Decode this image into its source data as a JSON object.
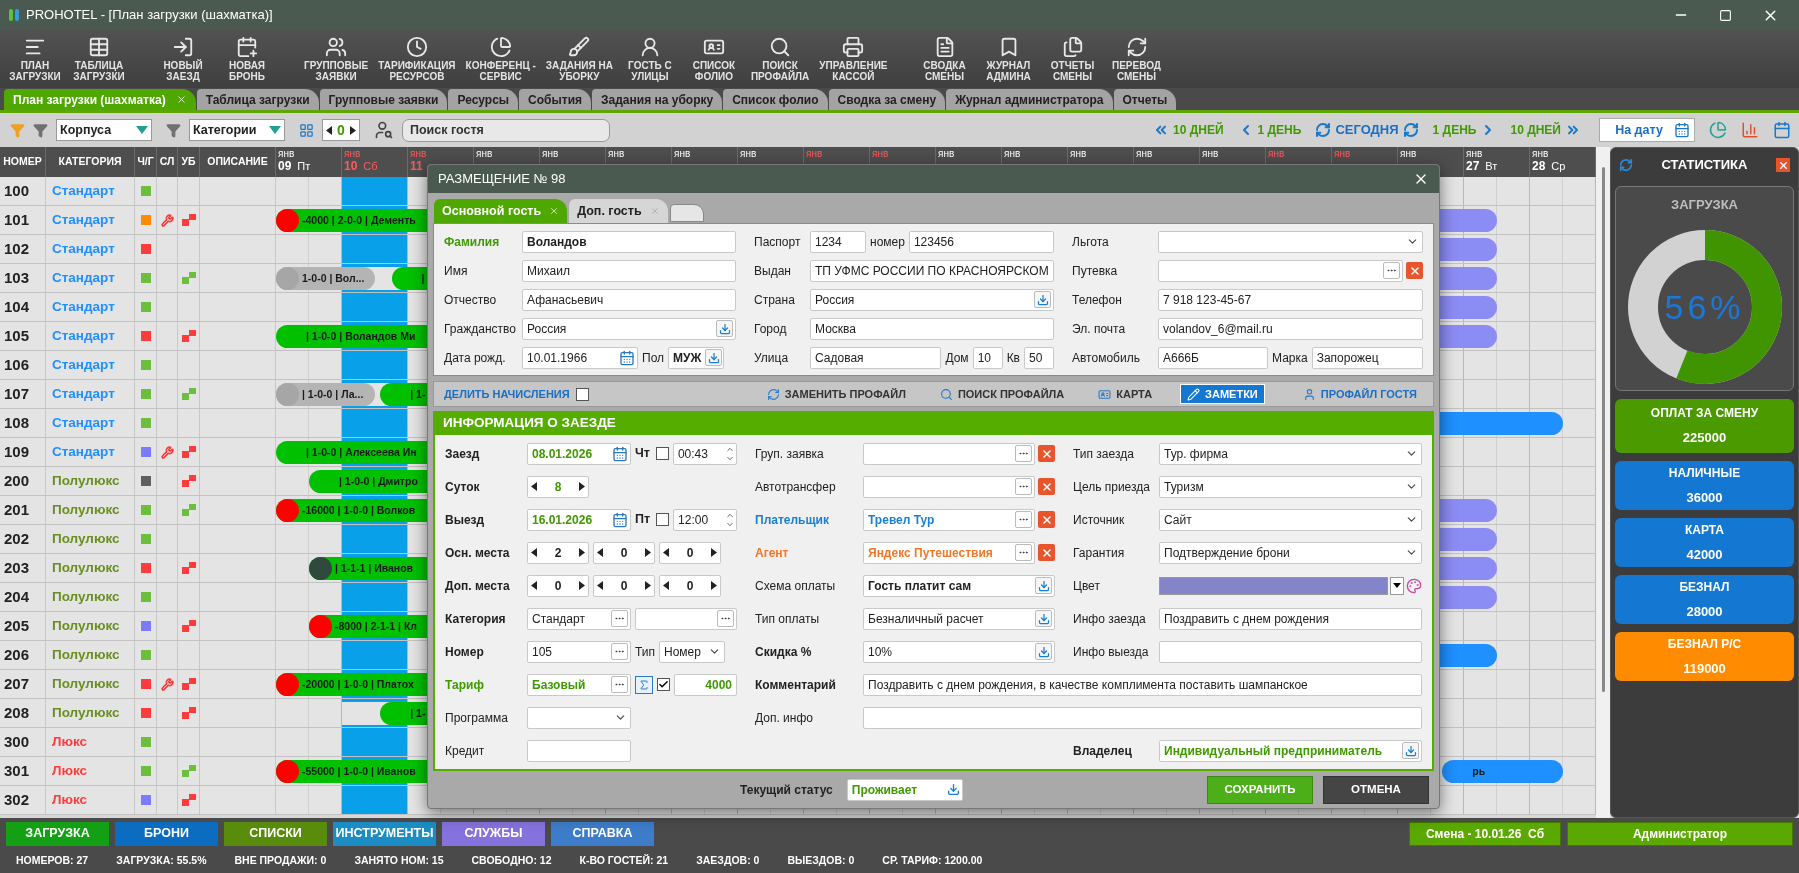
{
  "window": {
    "title": "PROHOTEL - [План загрузки (шахматка)]"
  },
  "toolbar": {
    "groups": [
      {
        "buttons": [
          "ПЛАН\nЗАГРУЗКИ",
          "ТАБЛИЦА\nЗАГРУЗКИ"
        ]
      },
      {
        "buttons": [
          "НОВЫЙ\nЗАЕЗД",
          "НОВАЯ\nБРОНЬ"
        ]
      },
      {
        "buttons": [
          "ГРУППОВЫЕ\nЗАЯВКИ",
          "ТАРИФИКАЦИЯ\nРЕСУРСОВ",
          "КОНФЕРЕНЦ -\nСЕРВИС",
          "ЗАДАНИЯ НА\nУБОРКУ",
          "ГОСТЬ С\nУЛИЦЫ",
          "СПИСОК\nФОЛИО",
          "ПОИСК\nПРОФАЙЛА",
          "УПРАВЛЕНИЕ\nКАССОЙ"
        ]
      },
      {
        "buttons": [
          "СВОДКА\nСМЕНЫ",
          "ЖУРНАЛ\nАДМИНА",
          "ОТЧЕТЫ\nСМЕНЫ",
          "ПЕРЕВОД\nСМЕНЫ"
        ]
      }
    ]
  },
  "tabs": [
    {
      "label": "План загрузки (шахматка)",
      "selected": true,
      "closable": true
    },
    {
      "label": "Таблица загрузки",
      "selected": false,
      "closable": false
    },
    {
      "label": "Групповые заявки",
      "selected": false,
      "closable": false
    },
    {
      "label": "Ресурсы",
      "selected": false,
      "closable": false
    },
    {
      "label": "События",
      "selected": false,
      "closable": false
    },
    {
      "label": "Задания на уборку",
      "selected": false,
      "closable": false
    },
    {
      "label": "Список фолио",
      "selected": false,
      "closable": false
    },
    {
      "label": "Сводка за смену",
      "selected": false,
      "closable": false
    },
    {
      "label": "Журнал администратора",
      "selected": false,
      "closable": false
    },
    {
      "label": "Отчеты",
      "selected": false,
      "closable": false
    }
  ],
  "filters": {
    "building": "Корпуса",
    "category": "Категории",
    "counter": "0",
    "search": {
      "placeholder": "Поиск гостя"
    }
  },
  "navigation": [
    {
      "label": "10 ДНЕЙ",
      "kind": "back10"
    },
    {
      "label": "1 ДЕНЬ",
      "kind": "back1"
    },
    {
      "label": "СЕГОДНЯ",
      "kind": "today"
    },
    {
      "label": "1 ДЕНЬ",
      "kind": "fwd1"
    },
    {
      "label": "10 ДНЕЙ",
      "kind": "fwd10"
    }
  ],
  "date_button": "На дату",
  "grid": {
    "columns": [
      "НОМЕР",
      "КАТЕГОРИЯ",
      "Ч/Г",
      "СЛ",
      "УБ",
      "ОПИСАНИЕ"
    ],
    "days": [
      {
        "month": "янв",
        "day": "09",
        "weekday": "Пт",
        "weekend": false,
        "today": false
      },
      {
        "month": "янв",
        "day": "10",
        "weekday": "Сб",
        "weekend": true,
        "today": true
      },
      {
        "month": "янв",
        "day": "11",
        "weekend": true,
        "today": false
      },
      {
        "month": "янв",
        "weekend": false
      },
      {
        "month": "янв",
        "weekend": false
      },
      {
        "month": "янв",
        "weekend": false
      },
      {
        "month": "янв",
        "weekend": false
      },
      {
        "month": "янв",
        "weekend": false
      },
      {
        "month": "янв",
        "weekend": true
      },
      {
        "month": "янв",
        "weekend": true
      },
      {
        "month": "янв",
        "weekend": false
      },
      {
        "month": "янв",
        "weekend": false
      },
      {
        "month": "янв",
        "weekend": false
      },
      {
        "month": "янв",
        "weekend": false
      },
      {
        "month": "янв",
        "weekend": false
      },
      {
        "month": "янв",
        "weekend": true
      },
      {
        "month": "янв",
        "weekend": true
      },
      {
        "month": "янв",
        "weekend": false
      },
      {
        "month": "янв",
        "day": "27",
        "weekday": "Вт",
        "weekend": false,
        "today": false
      },
      {
        "month": "янв",
        "day": "28",
        "weekday": "Ср",
        "weekend": false,
        "today": false
      }
    ],
    "rows": [
      {
        "number": "100",
        "category": {
          "label": "Стандарт",
          "color": "#1e90ff"
        },
        "status": {
          "color": "#6cbf3c"
        },
        "repair": false
      },
      {
        "number": "101",
        "category": {
          "label": "Стандарт",
          "color": "#1e90ff"
        },
        "status": {
          "color": "#ff8c00"
        },
        "repair": true,
        "cleaning": {
          "kind": "dirty"
        },
        "bookings": [
          {
            "text": "-4000 | 2-0-0 | Дементь",
            "color": "#00c000",
            "dot": {
              "color": "#ff0000"
            }
          },
          {
            "color": "#8c8cf5"
          }
        ]
      },
      {
        "number": "102",
        "category": {
          "label": "Стандарт",
          "color": "#1e90ff"
        },
        "status": {
          "color": "#ff3b3b"
        },
        "repair": false,
        "bookings": [
          {
            "color": "#8c8cf5"
          }
        ]
      },
      {
        "number": "103",
        "category": {
          "label": "Стандарт",
          "color": "#1e90ff"
        },
        "status": {
          "color": "#6cbf3c"
        },
        "repair": false,
        "cleaning": {
          "kind": "clean"
        },
        "bookings": [
          {
            "text": "1-0-0 | Вол...",
            "color": "#b4b4b4",
            "dot": {
              "color": "#a6a6a6"
            }
          },
          {
            "text": "|",
            "color": "#00c000"
          },
          {
            "color": "#8c8cf5"
          }
        ]
      },
      {
        "number": "104",
        "category": {
          "label": "Стандарт",
          "color": "#1e90ff"
        },
        "status": {
          "color": "#6cbf3c"
        },
        "repair": false,
        "bookings": [
          {
            "color": "#8c8cf5"
          }
        ]
      },
      {
        "number": "105",
        "category": {
          "label": "Стандарт",
          "color": "#1e90ff"
        },
        "status": {
          "color": "#ff3b3b"
        },
        "repair": false,
        "cleaning": {
          "kind": "dirty"
        },
        "bookings": [
          {
            "text": "| 1-0-0 | Воландов Ми",
            "color": "#00c000"
          },
          {
            "color": "#8c8cf5"
          }
        ]
      },
      {
        "number": "106",
        "category": {
          "label": "Стандарт",
          "color": "#1e90ff"
        },
        "status": {
          "color": "#6cbf3c"
        },
        "repair": false
      },
      {
        "number": "107",
        "category": {
          "label": "Стандарт",
          "color": "#1e90ff"
        },
        "status": {
          "color": "#6cbf3c"
        },
        "repair": false,
        "cleaning": {
          "kind": "clean"
        },
        "bookings": [
          {
            "text": "| 1-0-0 | Ла...",
            "color": "#b4b4b4",
            "dot": {
              "color": "#a6a6a6"
            }
          },
          {
            "text": "| 1-",
            "color": "#00c000"
          }
        ]
      },
      {
        "number": "108",
        "category": {
          "label": "Стандарт",
          "color": "#1e90ff"
        },
        "status": {
          "color": "#6cbf3c"
        },
        "repair": false,
        "bookings": [
          {
            "color": "#1e90ff"
          }
        ]
      },
      {
        "number": "109",
        "category": {
          "label": "Стандарт",
          "color": "#1e90ff"
        },
        "status": {
          "color": "#7b7bff"
        },
        "repair": true,
        "cleaning": {
          "kind": "dirty"
        },
        "bookings": [
          {
            "text": "| 1-0-0 | Алексеева Ин",
            "color": "#00c000"
          }
        ]
      },
      {
        "number": "200",
        "category": {
          "label": "Полулюкс",
          "color": "#6b8e23"
        },
        "status": {
          "color": "#5f5f5f"
        },
        "repair": false,
        "cleaning": {
          "kind": "dirty"
        },
        "bookings": [
          {
            "text": "| 1-0-0 | Дмитро",
            "color": "#00c000"
          }
        ]
      },
      {
        "number": "201",
        "category": {
          "label": "Полулюкс",
          "color": "#6b8e23"
        },
        "status": {
          "color": "#6cbf3c"
        },
        "repair": false,
        "cleaning": {
          "kind": "clean"
        },
        "bookings": [
          {
            "text": "-16000 | 1-0-0 | Волков",
            "color": "#00c000",
            "dot": {
              "color": "#ff0000"
            }
          },
          {
            "color": "#8c8cf5"
          }
        ]
      },
      {
        "number": "202",
        "category": {
          "label": "Полулюкс",
          "color": "#6b8e23"
        },
        "status": {
          "color": "#6cbf3c"
        },
        "repair": false,
        "bookings": [
          {
            "color": "#8c8cf5"
          }
        ]
      },
      {
        "number": "203",
        "category": {
          "label": "Полулюкс",
          "color": "#6b8e23"
        },
        "status": {
          "color": "#ff3b3b"
        },
        "repair": false,
        "cleaning": {
          "kind": "dirty"
        },
        "bookings": [
          {
            "text": "| 1-1-1 | Иванов",
            "color": "#00c000",
            "dot": {
              "color": "#2f4a3c"
            }
          },
          {
            "color": "#8c8cf5"
          }
        ]
      },
      {
        "number": "204",
        "category": {
          "label": "Полулюкс",
          "color": "#6b8e23"
        },
        "status": {
          "color": "#6cbf3c"
        },
        "repair": false,
        "bookings": [
          {
            "color": "#8c8cf5"
          }
        ]
      },
      {
        "number": "205",
        "category": {
          "label": "Полулюкс",
          "color": "#6b8e23"
        },
        "status": {
          "color": "#7b7bff"
        },
        "repair": false,
        "cleaning": {
          "kind": "dirty"
        },
        "bookings": [
          {
            "text": "-8000 | 2-1-1 | Кл",
            "color": "#00c000",
            "dot": {
              "color": "#ff0000"
            }
          }
        ]
      },
      {
        "number": "206",
        "category": {
          "label": "Полулюкс",
          "color": "#6b8e23"
        },
        "status": {
          "color": "#6cbf3c"
        },
        "repair": false,
        "bookings": [
          {
            "color": "#1e90ff"
          }
        ]
      },
      {
        "number": "207",
        "category": {
          "label": "Полулюкс",
          "color": "#6b8e23"
        },
        "status": {
          "color": "#ff3b3b"
        },
        "repair": true,
        "cleaning": {
          "kind": "dirty"
        },
        "bookings": [
          {
            "text": "-20000 | 1-0-0 | Платох",
            "color": "#00c000",
            "dot": {
              "color": "#ff0000"
            }
          }
        ]
      },
      {
        "number": "208",
        "category": {
          "label": "Полулюкс",
          "color": "#6b8e23"
        },
        "status": {
          "color": "#ff3b3b"
        },
        "repair": false,
        "cleaning": {
          "kind": "dirty"
        },
        "bookings": [
          {
            "text": "| 1-",
            "color": "#00c000"
          }
        ]
      },
      {
        "number": "300",
        "category": {
          "label": "Люкс",
          "color": "#ff3b3b"
        },
        "status": {
          "color": "#6cbf3c"
        },
        "repair": false
      },
      {
        "number": "301",
        "category": {
          "label": "Люкс",
          "color": "#ff3b3b"
        },
        "status": {
          "color": "#6cbf3c"
        },
        "repair": false,
        "cleaning": {
          "kind": "clean"
        },
        "bookings": [
          {
            "text": "-55000 | 1-0-0 | Иванов",
            "color": "#00c000",
            "dot": {
              "color": "#ff0000"
            }
          },
          {
            "text": "рь",
            "color": "#1e90ff"
          }
        ]
      },
      {
        "number": "302",
        "category": {
          "label": "Люкс",
          "color": "#ff3b3b"
        },
        "status": {
          "color": "#7b7bff"
        },
        "repair": false,
        "cleaning": {
          "kind": "dirty"
        }
      }
    ]
  },
  "dialog": {
    "title": "РАЗМЕЩЕНИЕ № 98",
    "tabs": [
      {
        "label": "Основной гость",
        "selected": true
      },
      {
        "label": "Доп. гость",
        "selected": false
      }
    ],
    "guest": {
      "rows": [
        {
          "cells": [
            {
              "label": "Фамилия",
              "color": "#3f9a00",
              "bold": true,
              "parts": [
                {
                  "kind": "text",
                  "value": "Воландов",
                  "bold": true
                }
              ]
            },
            {
              "label": "Паспорт",
              "parts": [
                {
                  "kind": "text",
                  "value": "1234"
                },
                {
                  "label": "номер",
                  "kind": "text",
                  "value": "123456"
                }
              ]
            },
            {
              "label": "Льгота",
              "parts": [
                {
                  "kind": "select"
                }
              ]
            }
          ]
        },
        {
          "cells": [
            {
              "label": "Имя",
              "parts": [
                {
                  "kind": "text",
                  "value": "Михаил"
                }
              ]
            },
            {
              "label": "Выдан",
              "parts": [
                {
                  "kind": "text",
                  "value": "ТП УФМС РОССИИ ПО КРАСНОЯРСКОМ"
                }
              ]
            },
            {
              "label": "Путевка",
              "parts": [
                {
                  "kind": "lookup"
                }
              ]
            }
          ]
        },
        {
          "cells": [
            {
              "label": "Отчество",
              "parts": [
                {
                  "kind": "text",
                  "value": "Афанасьевич"
                }
              ]
            },
            {
              "label": "Страна",
              "parts": [
                {
                  "kind": "picker",
                  "value": "Россия"
                }
              ]
            },
            {
              "label": "Телефон",
              "parts": [
                {
                  "kind": "text",
                  "value": "7 918 123-45-67"
                }
              ]
            }
          ]
        },
        {
          "cells": [
            {
              "label": "Гражданство",
              "parts": [
                {
                  "kind": "picker",
                  "value": "Россия"
                }
              ]
            },
            {
              "label": "Город",
              "parts": [
                {
                  "kind": "text",
                  "value": "Москва"
                }
              ]
            },
            {
              "label": "Эл. почта",
              "parts": [
                {
                  "kind": "text",
                  "value": "volandov_6@mail.ru"
                }
              ]
            }
          ]
        },
        {
          "cells": [
            {
              "label": "Дата рожд.",
              "parts": [
                {
                  "kind": "date",
                  "value": "10.01.1966"
                },
                {
                  "label": "Пол",
                  "kind": "picker",
                  "value": "МУЖ",
                  "bold": true
                }
              ]
            },
            {
              "label": "Улица",
              "parts": [
                {
                  "kind": "text",
                  "value": "Садовая"
                },
                {
                  "label": "Дом",
                  "kind": "text",
                  "value": "10"
                },
                {
                  "label": "Кв",
                  "kind": "text",
                  "value": "50"
                }
              ]
            },
            {
              "label": "Автомобиль",
              "parts": [
                {
                  "kind": "text",
                  "value": "А666Б"
                },
                {
                  "label": "Марка",
                  "kind": "text",
                  "value": "Запорожец"
                }
              ]
            }
          ]
        }
      ]
    },
    "actions": [
      {
        "label": "ДЕЛИТЬ НАЧИСЛЕНИЯ",
        "kind": "check",
        "checked": false
      },
      {
        "label": "ЗАМЕНИТЬ ПРОФАЙЛ",
        "kind": "replace",
        "selected": false
      },
      {
        "label": "ПОИСК ПРОФАЙЛА",
        "kind": "search",
        "selected": false
      },
      {
        "label": "КАРТА",
        "kind": "card",
        "selected": false
      },
      {
        "label": "ЗАМЕТКИ",
        "kind": "notes",
        "selected": true
      },
      {
        "label": "ПРОФАЙЛ ГОСТЯ",
        "kind": "profile",
        "selected": false
      }
    ],
    "section_title": "ИНФОРМАЦИЯ О ЗАЕЗДЕ",
    "arrival": {
      "rows": [
        {
          "cells": [
            {
              "label": "Заезд",
              "bold": true,
              "parts": [
                {
                  "kind": "date",
                  "value": "08.01.2026",
                  "color": "#3f9a00",
                  "bold": true
                },
                {
                  "kind": "check",
                  "label": "Чт",
                  "checked": false
                },
                {
                  "kind": "time",
                  "value": "00:43"
                }
              ]
            },
            {
              "label": "Груп. заявка",
              "parts": [
                {
                  "kind": "lookup"
                }
              ]
            },
            {
              "label": "Тип заезда",
              "parts": [
                {
                  "kind": "select",
                  "value": "Тур. фирма"
                }
              ]
            }
          ]
        },
        {
          "cells": [
            {
              "label": "Суток",
              "bold": true,
              "parts": [
                {
                  "kind": "spin",
                  "value": "8",
                  "color": "#3f9a00",
                  "bold": true
                }
              ]
            },
            {
              "label": "Автотрансфер",
              "parts": [
                {
                  "kind": "lookup"
                }
              ]
            },
            {
              "label": "Цель приезда",
              "parts": [
                {
                  "kind": "select",
                  "value": "Туризм"
                }
              ]
            }
          ]
        },
        {
          "cells": [
            {
              "label": "Выезд",
              "bold": true,
              "parts": [
                {
                  "kind": "date",
                  "value": "16.01.2026",
                  "color": "#3f9a00",
                  "bold": true
                },
                {
                  "kind": "check",
                  "label": "Пт",
                  "checked": false
                },
                {
                  "kind": "time",
                  "value": "12:00"
                }
              ]
            },
            {
              "label": "Плательщик",
              "color": "#1a7fd4",
              "bold": true,
              "parts": [
                {
                  "kind": "lookup",
                  "value": "Тревел Тур",
                  "color": "#1a7fd4",
                  "bold": true
                }
              ]
            },
            {
              "label": "Источник",
              "parts": [
                {
                  "kind": "select",
                  "value": "Сайт"
                }
              ]
            }
          ]
        },
        {
          "cells": [
            {
              "label": "Осн. места",
              "bold": true,
              "parts": [
                {
                  "kind": "spin",
                  "value": "2",
                  "bold": true
                },
                {
                  "kind": "spin",
                  "value": "0",
                  "bold": true
                },
                {
                  "kind": "spin",
                  "value": "0",
                  "bold": true
                }
              ]
            },
            {
              "label": "Агент",
              "color": "#f07828",
              "bold": true,
              "parts": [
                {
                  "kind": "lookup",
                  "value": "Яндекс Путешествия",
                  "color": "#f07828",
                  "bold": true
                }
              ]
            },
            {
              "label": "Гарантия",
              "parts": [
                {
                  "kind": "select",
                  "value": "Подтверждение брони"
                }
              ]
            }
          ]
        },
        {
          "cells": [
            {
              "label": "Доп. места",
              "bold": true,
              "parts": [
                {
                  "kind": "spin",
                  "value": "0",
                  "bold": true
                },
                {
                  "kind": "spin",
                  "value": "0",
                  "bold": true
                },
                {
                  "kind": "spin",
                  "value": "0",
                  "bold": true
                }
              ]
            },
            {
              "label": "Схема оплаты",
              "parts": [
                {
                  "kind": "picker",
                  "value": "Гость платит сам",
                  "bold": true
                }
              ]
            },
            {
              "label": "Цвет",
              "parts": [
                {
                  "kind": "color",
                  "color": "#8484c8"
                }
              ]
            }
          ]
        },
        {
          "cells": [
            {
              "label": "Категория",
              "bold": true,
              "parts": [
                {
                  "kind": "browse",
                  "value": "Стандарт"
                },
                {
                  "kind": "browse"
                }
              ]
            },
            {
              "label": "Тип оплаты",
              "parts": [
                {
                  "kind": "picker",
                  "value": "Безналичный расчет"
                }
              ]
            },
            {
              "label": "Инфо заезда",
              "parts": [
                {
                  "kind": "text",
                  "value": "Поздравить с днем рождения"
                }
              ]
            }
          ]
        },
        {
          "cells": [
            {
              "label": "Номер",
              "bold": true,
              "parts": [
                {
                  "kind": "browse",
                  "value": "105"
                },
                {
                  "label": "Тип",
                  "kind": "select",
                  "value": "Номер"
                }
              ]
            },
            {
              "label": "Скидка  %",
              "bold": true,
              "parts": [
                {
                  "kind": "picker",
                  "value": "10%"
                }
              ]
            },
            {
              "label": "Инфо выезда",
              "parts": [
                {
                  "kind": "text"
                }
              ]
            }
          ]
        },
        {
          "cells": [
            {
              "label": "Тариф",
              "color": "#3f9a00",
              "bold": true,
              "parts": [
                {
                  "kind": "browse",
                  "value": "Базовый",
                  "color": "#3f9a00",
                  "bold": true
                },
                {
                  "kind": "sum",
                  "checked": true
                },
                {
                  "kind": "text",
                  "value": "4000",
                  "color": "#3f9a00",
                  "bold": true
                }
              ]
            },
            {
              "label": "Комментарий",
              "bold": true,
              "wide": true,
              "parts": [
                {
                  "kind": "text",
                  "value": "Поздравить с днем рождения, в качестве комплимента поставить шампанское"
                }
              ]
            }
          ]
        },
        {
          "cells": [
            {
              "label": "Программа",
              "parts": [
                {
                  "kind": "select"
                }
              ]
            },
            {
              "label": "Доп. инфо",
              "wide": true,
              "parts": [
                {
                  "kind": "text"
                }
              ]
            }
          ]
        },
        {
          "cells": [
            {
              "label": "Кредит",
              "parts": [
                {
                  "kind": "text"
                }
              ]
            },
            {
              "label": "Владелец",
              "bold": true,
              "parts": [
                {
                  "kind": "picker",
                  "value": "Индивидуальный предприниматель",
                  "color": "#3f9a00",
                  "bold": true
                }
              ]
            }
          ]
        }
      ]
    },
    "footer": {
      "status_label": "Текущий статус",
      "status": "Проживает",
      "buttons": [
        {
          "label": "СОХРАНИТЬ",
          "kind": "primary"
        },
        {
          "label": "ОТМЕНА",
          "kind": "secondary"
        }
      ]
    }
  },
  "stats": {
    "title": "СТАТИСТИКА",
    "load": {
      "title": "ЗАГРУЗКА",
      "value": "56%",
      "level": 0.56
    },
    "cards": [
      {
        "title": "ОПЛАТ ЗА СМЕНУ",
        "value": "225000",
        "color": "#4a9a00"
      },
      {
        "title": "НАЛИЧНЫЕ",
        "value": "36000",
        "color": "#1478d2"
      },
      {
        "title": "КАРТА",
        "value": "42000",
        "color": "#1478d2"
      },
      {
        "title": "БЕЗНАЛ",
        "value": "28000",
        "color": "#1478d2"
      },
      {
        "title": "БЕЗНАЛ Р/С",
        "value": "119000",
        "color": "#ff8c00"
      }
    ]
  },
  "bottom_tabs": [
    {
      "label": "ЗАГРУЗКА",
      "color": "#14a014"
    },
    {
      "label": "БРОНИ",
      "color": "#0b6cc0"
    },
    {
      "label": "СПИСКИ",
      "color": "#5a8c0c"
    },
    {
      "label": "ИНСТРУМЕНТЫ",
      "color": "#1b8cc4"
    },
    {
      "label": "СЛУЖБЫ",
      "color": "#8572dc"
    },
    {
      "label": "СПРАВКА",
      "color": "#3d7cc9"
    }
  ],
  "shift": "Смена - 10.01.26  Сб",
  "user": "Администратор",
  "status_bar": [
    "НОМЕРОВ: 27",
    "ЗАГРУЗКА: 55.5%",
    "ВНЕ ПРОДАЖИ: 0",
    "ЗАНЯТО НОМ: 15",
    "СВОБОДНО: 12",
    "К-ВО ГОСТЕЙ: 21",
    "ЗАЕЗДОВ: 0",
    "ВЫЕЗДОВ: 0",
    "СР. ТАРИФ: 1200.00"
  ]
}
